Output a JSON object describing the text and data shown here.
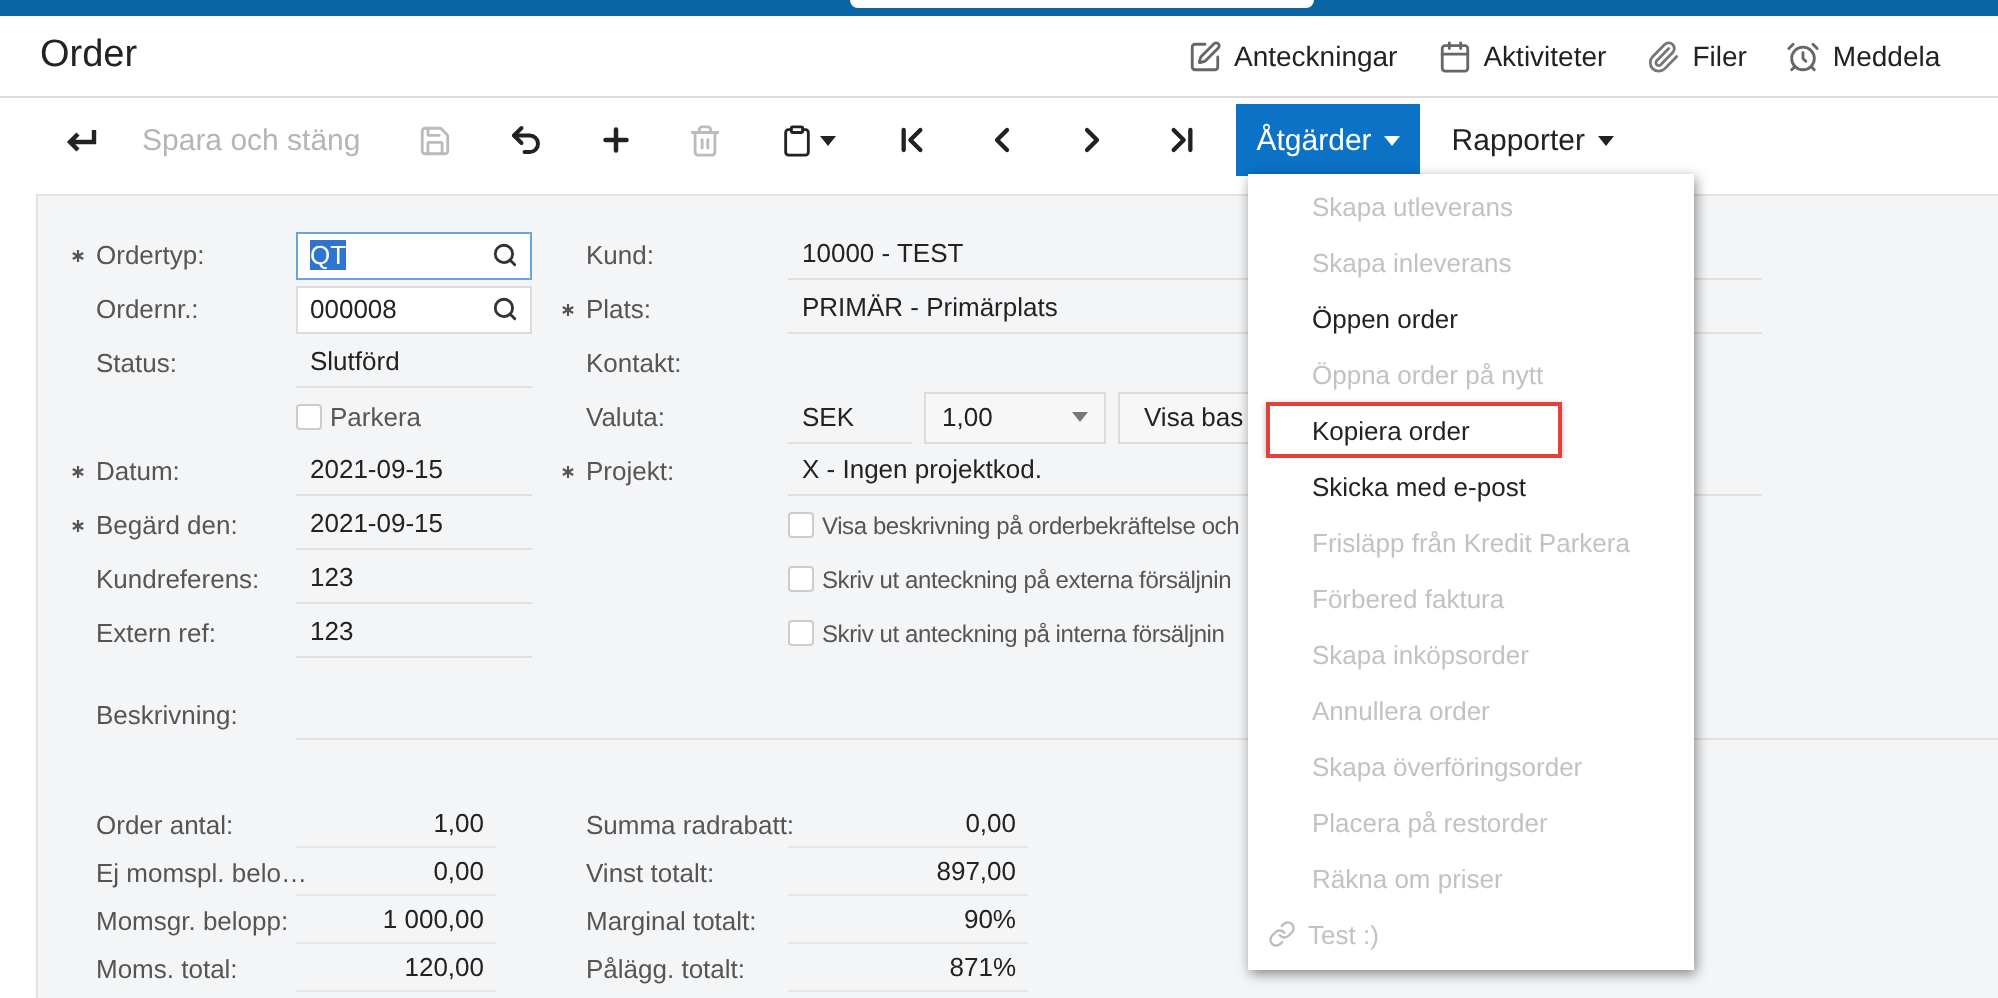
{
  "page_title": "Order",
  "header_links": [
    {
      "label": "Anteckningar",
      "kind": "notes"
    },
    {
      "label": "Aktiviteter",
      "kind": "activities"
    },
    {
      "label": "Filer",
      "kind": "files"
    },
    {
      "label": "Meddela",
      "kind": "notify"
    }
  ],
  "toolbar": [
    {
      "kind": "back",
      "disabled": false
    },
    {
      "kind": "text",
      "label": "Spara och stäng",
      "disabled": true
    },
    {
      "kind": "save",
      "disabled": true
    },
    {
      "kind": "undo",
      "disabled": false
    },
    {
      "kind": "add",
      "disabled": false
    },
    {
      "kind": "delete",
      "disabled": true
    },
    {
      "kind": "clipboard",
      "disabled": false
    },
    {
      "kind": "first",
      "disabled": false
    },
    {
      "kind": "prev",
      "disabled": false
    },
    {
      "kind": "next",
      "disabled": false
    },
    {
      "kind": "last",
      "disabled": false
    },
    {
      "kind": "menu",
      "label": "Åtgärder",
      "selected": true
    },
    {
      "kind": "menu",
      "label": "Rapporter",
      "selected": false
    }
  ],
  "form_left": [
    {
      "kind": "lookup",
      "label": "Ordertyp:",
      "required": true,
      "value": "QT",
      "focused": true
    },
    {
      "kind": "lookup",
      "label": "Ordernr.:",
      "required": false,
      "value": "000008",
      "focused": false
    },
    {
      "kind": "text",
      "label": "Status:",
      "required": false,
      "value": "Slutförd"
    },
    {
      "kind": "checkbox",
      "label": "Parkera",
      "checked": false
    },
    {
      "kind": "text",
      "label": "Datum:",
      "required": true,
      "value": "2021-09-15"
    },
    {
      "kind": "text",
      "label": "Begärd den:",
      "required": true,
      "value": "2021-09-15"
    },
    {
      "kind": "text",
      "label": "Kundreferens:",
      "required": false,
      "value": "123"
    },
    {
      "kind": "text",
      "label": "Extern ref:",
      "required": false,
      "value": "123"
    }
  ],
  "form_right": [
    {
      "kind": "text",
      "label": "Kund:",
      "required": false,
      "value": "10000 - TEST"
    },
    {
      "kind": "text",
      "label": "Plats:",
      "required": true,
      "value": "PRIMÄR - Primärplats"
    },
    {
      "kind": "text",
      "label": "Kontakt:",
      "required": false
    },
    {
      "kind": "currency",
      "label": "Valuta:",
      "required": false,
      "currency": "SEK",
      "rate": "1,00",
      "button": "Visa bas"
    },
    {
      "kind": "text",
      "label": "Projekt:",
      "required": true,
      "value": "X - Ingen projektkod."
    },
    {
      "kind": "checkbox",
      "label": "Visa beskrivning på orderbekräftelse och",
      "checked": false
    },
    {
      "kind": "checkbox",
      "label": "Skriv ut anteckning på externa försäljnin",
      "checked": false
    },
    {
      "kind": "checkbox",
      "label": "Skriv ut anteckning på interna försäljnin",
      "checked": false
    }
  ],
  "description": {
    "label": "Beskrivning:"
  },
  "totals_left": [
    {
      "label": "Order antal:",
      "value": "1,00"
    },
    {
      "label": "Ej momspl. belo…",
      "value": "0,00"
    },
    {
      "label": "Momsgr. belopp:",
      "value": "1 000,00"
    },
    {
      "label": "Moms. total:",
      "value": "120,00"
    }
  ],
  "totals_right": [
    {
      "label": "Summa radrabatt:",
      "value": "0,00"
    },
    {
      "label": "Vinst totalt:",
      "value": "897,00"
    },
    {
      "label": "Marginal totalt:",
      "value": "90%"
    },
    {
      "label": "Pålägg. totalt:",
      "value": "871%"
    }
  ],
  "actions_menu": [
    {
      "kind": "action",
      "label": "Skapa utleverans",
      "disabled": true,
      "highlighted": false
    },
    {
      "kind": "action",
      "label": "Skapa inleverans",
      "disabled": true,
      "highlighted": false
    },
    {
      "kind": "action",
      "label": "Öppen order",
      "disabled": false,
      "highlighted": false
    },
    {
      "kind": "action",
      "label": "Öppna order på nytt",
      "disabled": true,
      "highlighted": false
    },
    {
      "kind": "action",
      "label": "Kopiera order",
      "disabled": false,
      "highlighted": true
    },
    {
      "kind": "action",
      "label": "Skicka med e-post",
      "disabled": false,
      "highlighted": false
    },
    {
      "kind": "action",
      "label": "Frisläpp från Kredit Parkera",
      "disabled": true,
      "highlighted": false
    },
    {
      "kind": "action",
      "label": "Förbered faktura",
      "disabled": true,
      "highlighted": false
    },
    {
      "kind": "action",
      "label": "Skapa inköpsorder",
      "disabled": true,
      "highlighted": false
    },
    {
      "kind": "action",
      "label": "Annullera order",
      "disabled": true,
      "highlighted": false
    },
    {
      "kind": "action",
      "label": "Skapa överföringsorder",
      "disabled": true,
      "highlighted": false
    },
    {
      "kind": "action",
      "label": "Placera på restorder",
      "disabled": true,
      "highlighted": false
    },
    {
      "kind": "action",
      "label": "Räkna om priser",
      "disabled": true,
      "highlighted": false
    },
    {
      "kind": "link",
      "label": "Test :)",
      "disabled": true,
      "highlighted": false
    }
  ]
}
